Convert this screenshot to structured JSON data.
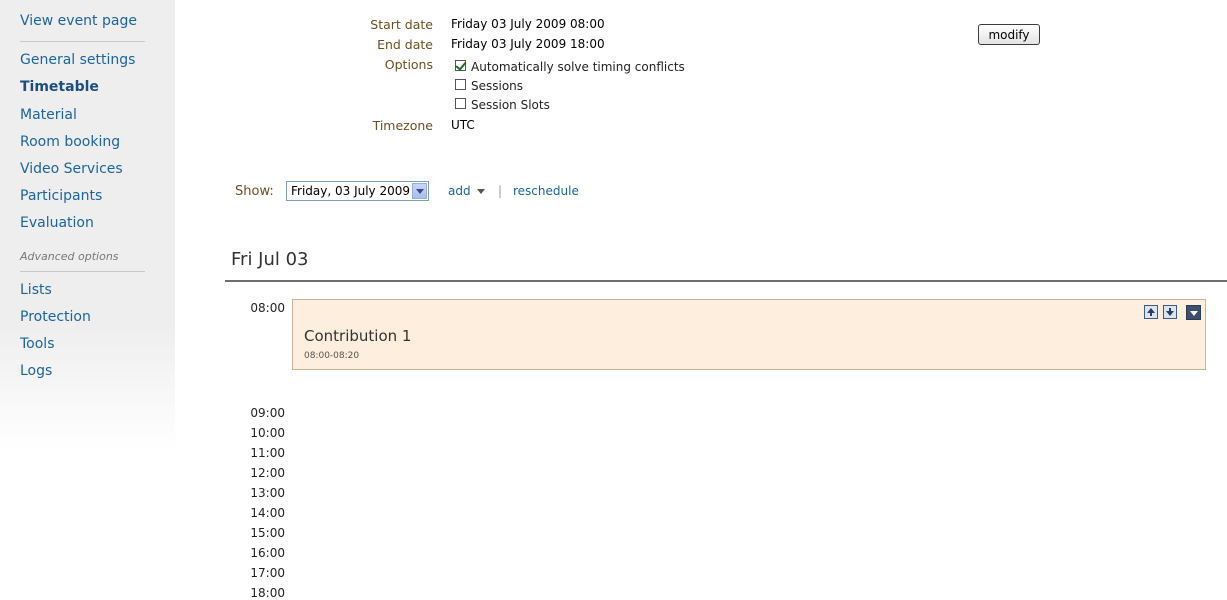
{
  "sidebar": {
    "items": [
      {
        "label": "View event page"
      },
      {
        "label": "General settings"
      },
      {
        "label": "Timetable"
      },
      {
        "label": "Material"
      },
      {
        "label": "Room booking"
      },
      {
        "label": "Video Services"
      },
      {
        "label": "Participants"
      },
      {
        "label": "Evaluation"
      }
    ],
    "section_label": "Advanced options",
    "advanced_items": [
      {
        "label": "Lists"
      },
      {
        "label": "Protection"
      },
      {
        "label": "Tools"
      },
      {
        "label": "Logs"
      }
    ]
  },
  "settings": {
    "start_date_label": "Start date",
    "start_date_value": "Friday 03 July 2009 08:00",
    "end_date_label": "End date",
    "end_date_value": "Friday 03 July 2009 18:00",
    "options_label": "Options",
    "options": [
      {
        "label": "Automatically solve timing conflicts",
        "checked": true
      },
      {
        "label": "Sessions",
        "checked": false
      },
      {
        "label": "Session Slots",
        "checked": false
      }
    ],
    "timezone_label": "Timezone",
    "timezone_value": "UTC",
    "modify_label": "modify"
  },
  "toolbar": {
    "show_label": "Show:",
    "selected_day": "Friday, 03 July 2009",
    "add_label": "add",
    "separator": "|",
    "reschedule_label": "reschedule"
  },
  "day": {
    "title": "Fri Jul 03",
    "hours": [
      "08:00",
      "09:00",
      "10:00",
      "11:00",
      "12:00",
      "13:00",
      "14:00",
      "15:00",
      "16:00",
      "17:00",
      "18:00"
    ]
  },
  "contribution": {
    "title": "Contribution 1",
    "time": "08:00-08:20"
  },
  "colors": {
    "link": "#1a64a0",
    "label": "#6a5020",
    "contribution_bg": "#fdeedd"
  }
}
